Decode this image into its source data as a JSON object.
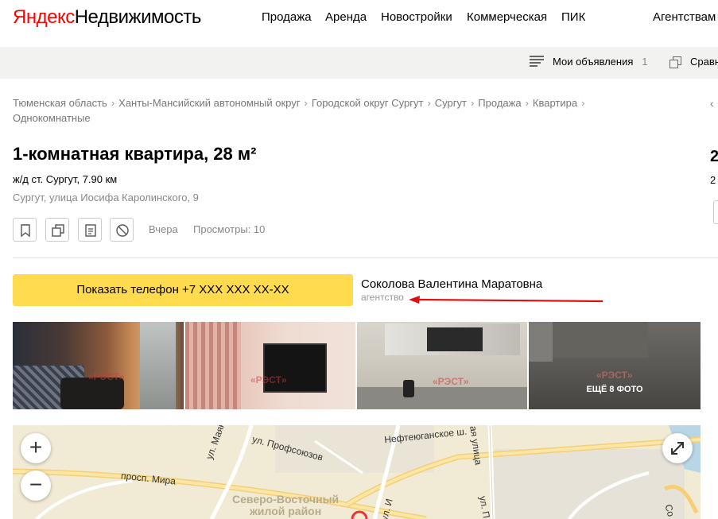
{
  "header": {
    "logo_brand": "Яндекс",
    "logo_product": "Недвижимость",
    "nav": [
      "Продажа",
      "Аренда",
      "Новостройки",
      "Коммерческая",
      "ПИК",
      "Агентствам"
    ]
  },
  "subbar": {
    "my_ads_label": "Мои объявления",
    "my_ads_count": "1",
    "compare_label": "Сравн"
  },
  "breadcrumbs": [
    "Тюменская область",
    "Ханты-Мансийский автономный округ",
    "Городской округ Сургут",
    "Сургут",
    "Продажа",
    "Квартира",
    "Однокомнатные"
  ],
  "listing": {
    "title": "1-комнатная квартира, 28 м²",
    "station": "ж/д ст. Сургут, 7.90 км",
    "address": "Сургут, улица Иосифа Каролинского, 9",
    "date": "Вчера",
    "views": "Просмотры: 10",
    "actions": [
      {
        "name": "bookmark-icon"
      },
      {
        "name": "compare-icon"
      },
      {
        "name": "note-icon"
      },
      {
        "name": "block-icon"
      }
    ]
  },
  "contact": {
    "phone_button": "Показать телефон +7 XXX XXX XX-XX",
    "seller_name": "Соколова Валентина Маратовна",
    "seller_type": "агентство"
  },
  "photos": {
    "watermark": "«РЭСТ»",
    "more_label": "ЕЩЁ 8 ФОТО"
  },
  "map": {
    "zoom_in": "+",
    "zoom_out": "−",
    "streets": [
      "Нефтеюганское ш.",
      "ул. Профсоюзов",
      "ул. Маяковской",
      "просп. Мира",
      "ая улица",
      "ул. И",
      "ул. П",
      "Со"
    ],
    "district": [
      "Северо-Восточный",
      "жилой район"
    ]
  },
  "colors": {
    "brand_red": "#ff0000",
    "phone_button": "#ffdb4d",
    "subbar": "#f2f2f0",
    "map_bg": "#f1ead4"
  }
}
